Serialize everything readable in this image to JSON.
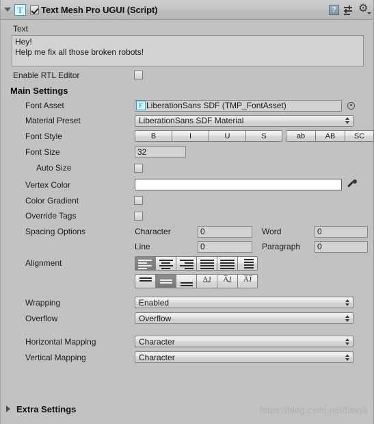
{
  "header": {
    "title": "Text Mesh Pro UGUI (Script)",
    "foldout_open": true,
    "enabled": true,
    "component_icon_letter": "T",
    "icons": [
      "help-icon",
      "preset-icon",
      "gear-icon"
    ]
  },
  "text_section": {
    "label": "Text",
    "value_line1": "Hey!",
    "value_line2": "Help me fix all those broken robots!"
  },
  "rtl": {
    "label": "Enable RTL Editor",
    "checked": false
  },
  "main_settings": {
    "title": "Main Settings",
    "font_asset": {
      "label": "Font Asset",
      "icon_letter": "F",
      "value": "LiberationSans SDF (TMP_FontAsset)"
    },
    "material_preset": {
      "label": "Material Preset",
      "value": "LiberationSans SDF Material"
    },
    "font_style": {
      "label": "Font Style",
      "group_a": [
        "B",
        "I",
        "U",
        "S"
      ],
      "group_b": [
        "ab",
        "AB",
        "SC"
      ],
      "active": []
    },
    "font_size": {
      "label": "Font Size",
      "value": "32"
    },
    "auto_size": {
      "label": "Auto Size",
      "checked": false
    },
    "vertex_color": {
      "label": "Vertex Color",
      "value": "#FFFFFF",
      "eyedropper": "eyedropper-icon"
    },
    "color_gradient": {
      "label": "Color Gradient",
      "checked": false
    },
    "override_tags": {
      "label": "Override Tags",
      "checked": false
    },
    "spacing": {
      "label": "Spacing Options",
      "character_label": "Character",
      "character_value": "0",
      "word_label": "Word",
      "word_value": "0",
      "line_label": "Line",
      "line_value": "0",
      "paragraph_label": "Paragraph",
      "paragraph_value": "0"
    },
    "alignment": {
      "label": "Alignment",
      "horizontal_selected_index": 0,
      "vertical_selected_index": 1,
      "horizontal_options": [
        "align-left",
        "align-center",
        "align-right",
        "align-justified",
        "align-flush",
        "align-geometry-center"
      ],
      "vertical_options": [
        "align-top",
        "align-middle",
        "align-bottom",
        "align-baseline",
        "align-midline",
        "align-capline"
      ]
    },
    "wrapping": {
      "label": "Wrapping",
      "value": "Enabled"
    },
    "overflow": {
      "label": "Overflow",
      "value": "Overflow"
    },
    "horizontal_mapping": {
      "label": "Horizontal Mapping",
      "value": "Character"
    },
    "vertical_mapping": {
      "label": "Vertical Mapping",
      "value": "Character"
    }
  },
  "extra_settings": {
    "title": "Extra Settings",
    "foldout_open": false
  },
  "watermark": {
    "text": "https://blog.csdn.net/bsxylj"
  }
}
